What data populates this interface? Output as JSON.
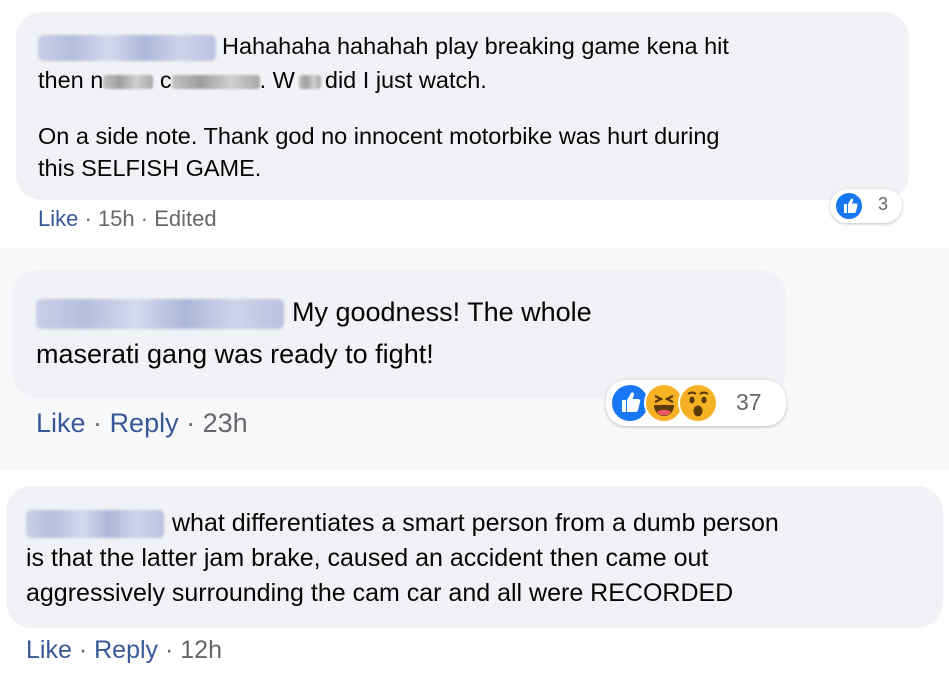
{
  "comments": [
    {
      "text_line1": "Hahahaha hahahah play breaking game kena hit",
      "text_line2_a": "then n",
      "text_line2_b": "c",
      "text_line2_c": ". W",
      "text_line2_d": "did I just watch.",
      "text_p2_line1": "On a side note. Thank god no innocent motorbike was hurt during",
      "text_p2_line2": "this SELFISH GAME.",
      "actions": {
        "like": "Like",
        "sep": "·",
        "time": "15h",
        "edited": "Edited"
      },
      "reaction_count": "3"
    },
    {
      "text_line1": "My goodness! The whole",
      "text_line2": "maserati gang was ready to fight!",
      "actions": {
        "like": "Like",
        "sep": "·",
        "reply": "Reply",
        "time": "23h"
      },
      "reaction_count": "37"
    },
    {
      "text_line1": "what differentiates a smart person from a dumb person",
      "text_line2": "is that the latter jam brake, caused an accident then came out",
      "text_line3": "aggressively surrounding the cam car and all were RECORDED",
      "actions": {
        "like": "Like",
        "sep": "·",
        "reply": "Reply",
        "time": "12h"
      }
    }
  ],
  "colors": {
    "bubble": "#f0f2f5",
    "link": "#385898",
    "meta": "#65676b",
    "like_reaction": "#1877f2",
    "emoji_yellow": "#f7b125"
  },
  "icons": {
    "like": "thumbs-up-icon",
    "haha": "laughing-face-icon",
    "wow": "surprised-face-icon"
  }
}
